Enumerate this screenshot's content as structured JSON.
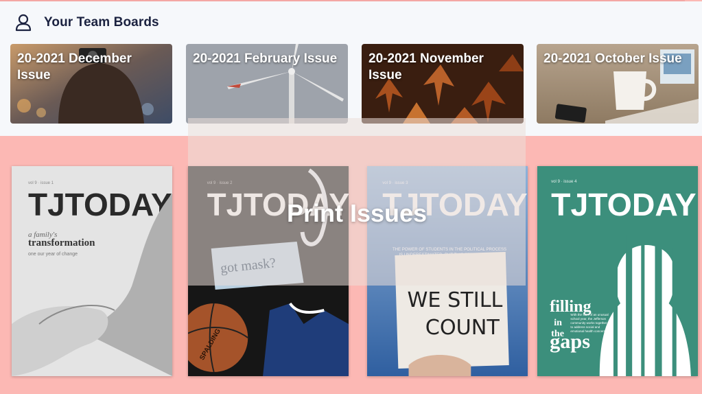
{
  "team_boards": {
    "title": "Your Team Boards",
    "icon": "user-icon",
    "boards": [
      {
        "label": "20-2021 December Issue"
      },
      {
        "label": "20-2021 February Issue"
      },
      {
        "label": "20-2021 November Issue"
      },
      {
        "label": "20-2021 October Issue"
      }
    ]
  },
  "print_issues": {
    "title": "Print Issues",
    "covers": [
      {
        "masthead": "TJTODAY",
        "headline_small": "a family's",
        "headline": "transformation",
        "sub": "one our year of change"
      },
      {
        "masthead": "TJTODAY",
        "headline": "got mask?",
        "sub": "SPALDING"
      },
      {
        "masthead": "TJTODAY",
        "blurb": "THE POWER OF STUDENTS IN THE POLITICAL PROCESS IS UNDERESTIMATED, BUT THIS SPECIAL EDITION AFFIRMS THAT",
        "sign_line1": "WE STILL",
        "sign_line2": "COUNT"
      },
      {
        "masthead": "TJTODAY",
        "headline_1": "filling",
        "headline_2": "in",
        "headline_3": "the",
        "headline_4": "gaps",
        "blurb": "With the start of an unusual school year, the Jefferson community works together to address social and emotional health concerns"
      }
    ]
  },
  "colors": {
    "page_bg": "#fcb8b4",
    "panel_bg": "#f6f8fb",
    "title_color": "#1b2240",
    "cover4_bg": "#3c8f7c"
  }
}
